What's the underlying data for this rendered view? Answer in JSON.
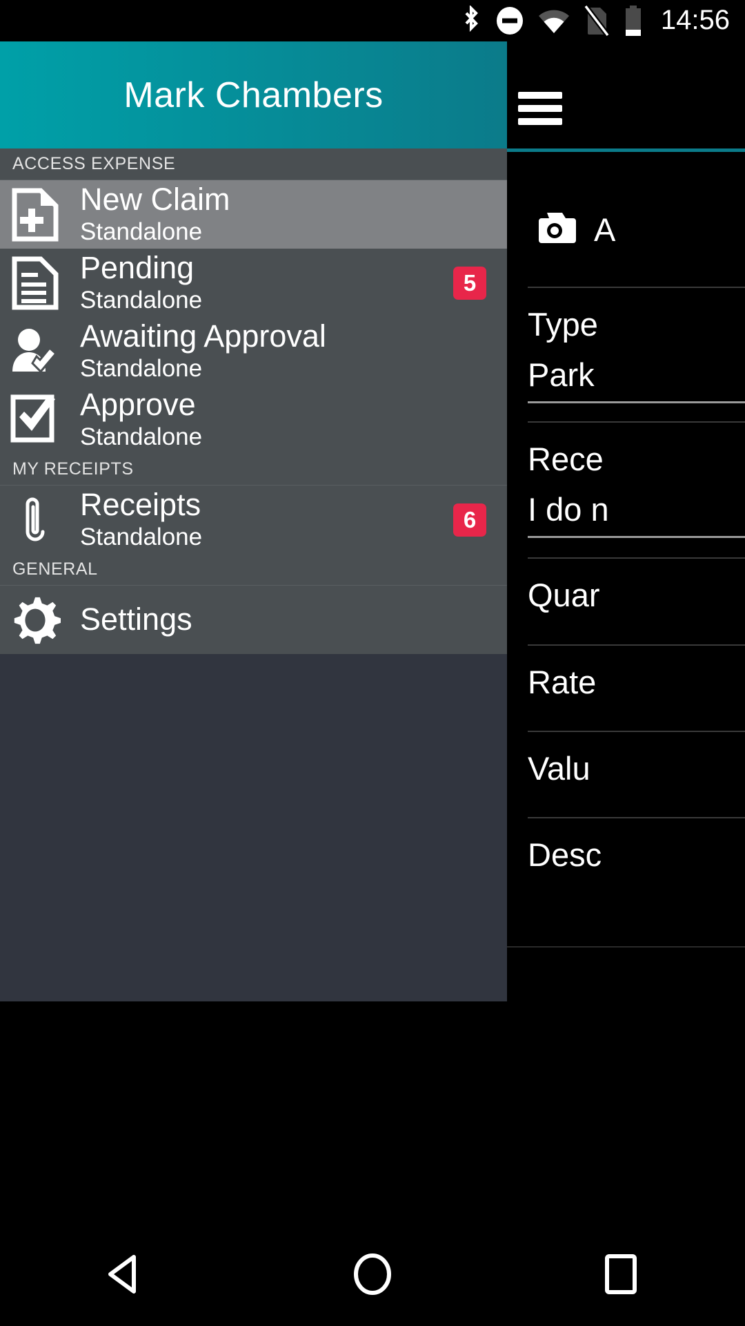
{
  "status_bar": {
    "icons": [
      "bluetooth-icon",
      "do-not-disturb-icon",
      "wifi-icon",
      "no-sim-icon",
      "battery-icon"
    ],
    "clock": "14:56"
  },
  "app_bar": {
    "title": "Mark Chambers",
    "menu_icon": "hamburger-menu-icon",
    "background_color": "#00a0a8"
  },
  "drawer": {
    "sections": [
      {
        "header": "ACCESS EXPENSE",
        "items": [
          {
            "title": "New Claim",
            "subtitle": "Standalone",
            "icon": "document-add-icon",
            "badge": "",
            "selected": true
          },
          {
            "title": "Pending",
            "subtitle": "Standalone",
            "icon": "document-lines-icon",
            "badge": "5",
            "selected": false
          },
          {
            "title": "Awaiting Approval",
            "subtitle": "Standalone",
            "icon": "person-check-icon",
            "badge": "",
            "selected": false
          },
          {
            "title": "Approve",
            "subtitle": "Standalone",
            "icon": "checkbox-checked-icon",
            "badge": "",
            "selected": false
          }
        ]
      },
      {
        "header": "MY RECEIPTS",
        "items": [
          {
            "title": "Receipts",
            "subtitle": "Standalone",
            "icon": "paperclip-icon",
            "badge": "6",
            "selected": false
          }
        ]
      },
      {
        "header": "GENERAL",
        "items": [
          {
            "title": "Settings",
            "subtitle": "",
            "icon": "gear-icon",
            "badge": "",
            "selected": false
          }
        ]
      }
    ],
    "badge_color": "#e8264a",
    "selected_row_color": "#808285",
    "row_color": "#4a4f52"
  },
  "content": {
    "attach_icon": "camera-icon",
    "attach_label": "A",
    "fields": [
      {
        "label": "Type",
        "value": "Park"
      },
      {
        "label": "Rece",
        "value": "I do n"
      },
      {
        "label": "Quar",
        "value": ""
      },
      {
        "label": "Rate",
        "value": ""
      },
      {
        "label": "Valu",
        "value": ""
      },
      {
        "label": "Desc",
        "value": ""
      }
    ]
  },
  "nav_bar": {
    "back": "back-triangle-icon",
    "home": "home-circle-icon",
    "recents": "recents-square-icon"
  }
}
